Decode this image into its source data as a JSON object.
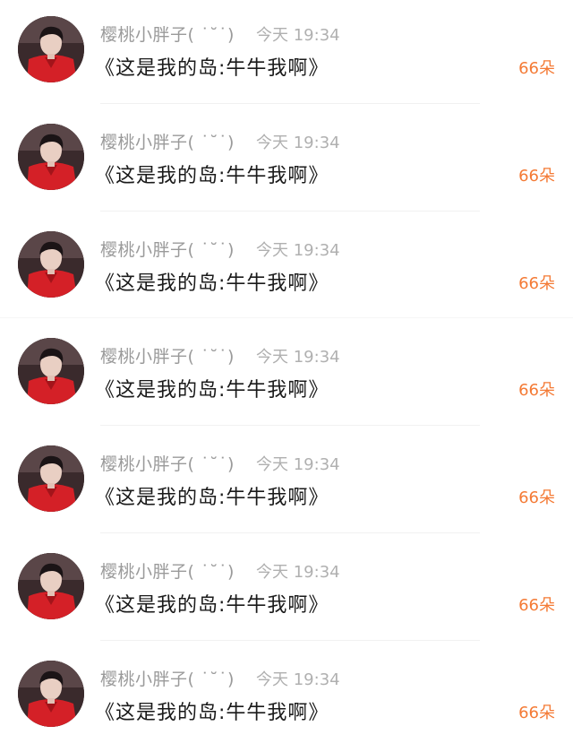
{
  "colors": {
    "accent": "#f47a35",
    "name_text": "#9a9a9a",
    "time_text": "#b0b0b0",
    "title_text": "#1a1a1a",
    "avatar_shirt": "#d42027"
  },
  "feed": {
    "items": [
      {
        "username": "樱桃小胖子( ˙˘˙)",
        "time": "今天 19:34",
        "title": "《这是我的岛:牛牛我啊》",
        "count": "66朵",
        "avatar_icon": "user-avatar"
      },
      {
        "username": "樱桃小胖子( ˙˘˙)",
        "time": "今天 19:34",
        "title": "《这是我的岛:牛牛我啊》",
        "count": "66朵",
        "avatar_icon": "user-avatar"
      },
      {
        "username": "樱桃小胖子( ˙˘˙)",
        "time": "今天 19:34",
        "title": "《这是我的岛:牛牛我啊》",
        "count": "66朵",
        "avatar_icon": "user-avatar"
      },
      {
        "username": "樱桃小胖子( ˙˘˙)",
        "time": "今天 19:34",
        "title": "《这是我的岛:牛牛我啊》",
        "count": "66朵",
        "avatar_icon": "user-avatar"
      },
      {
        "username": "樱桃小胖子( ˙˘˙)",
        "time": "今天 19:34",
        "title": "《这是我的岛:牛牛我啊》",
        "count": "66朵",
        "avatar_icon": "user-avatar"
      },
      {
        "username": "樱桃小胖子( ˙˘˙)",
        "time": "今天 19:34",
        "title": "《这是我的岛:牛牛我啊》",
        "count": "66朵",
        "avatar_icon": "user-avatar"
      },
      {
        "username": "樱桃小胖子( ˙˘˙)",
        "time": "今天 19:34",
        "title": "《这是我的岛:牛牛我啊》",
        "count": "66朵",
        "avatar_icon": "user-avatar"
      }
    ]
  }
}
